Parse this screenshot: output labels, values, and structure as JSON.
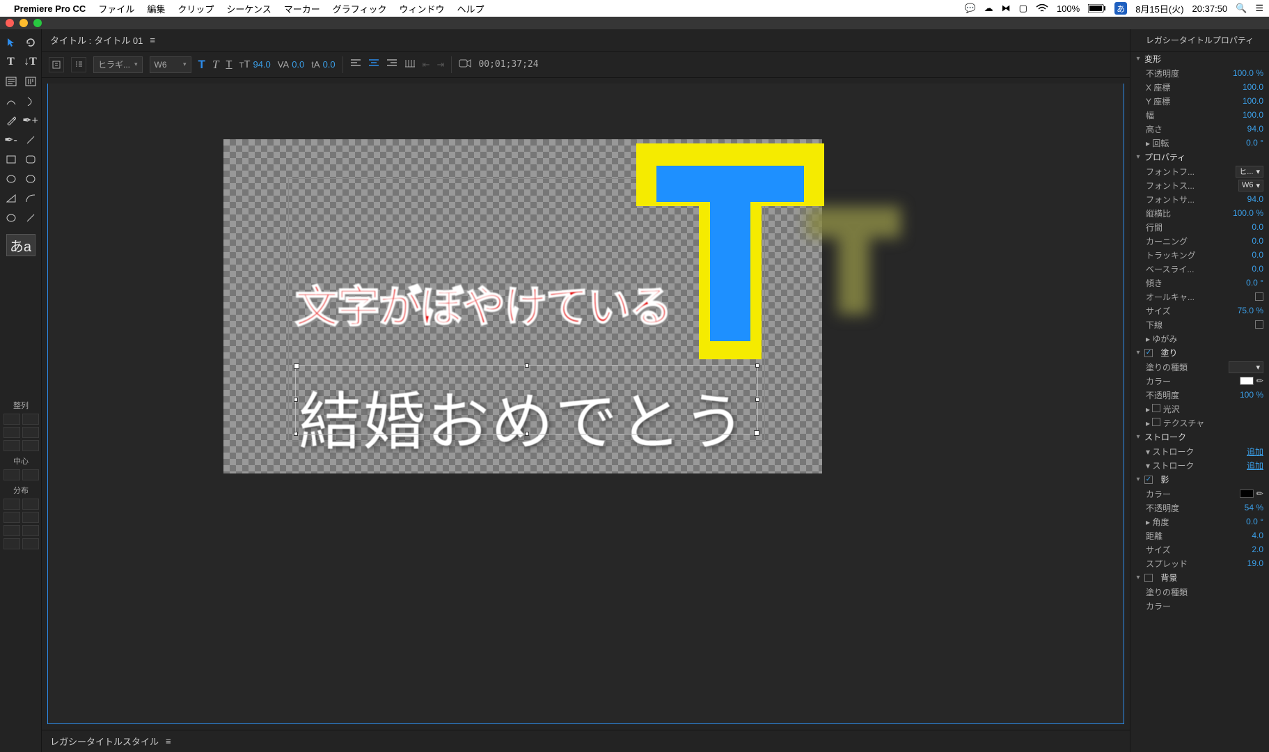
{
  "menubar": {
    "app": "Premiere Pro CC",
    "items": [
      "ファイル",
      "編集",
      "クリップ",
      "シーケンス",
      "マーカー",
      "グラフィック",
      "ウィンドウ",
      "ヘルプ"
    ],
    "battery": "100%",
    "ime": "あ",
    "date": "8月15日(火)",
    "time": "20:37:50"
  },
  "window": {
    "title_prefix": "タイトル : ",
    "title": "タイトル 01"
  },
  "toolbar": {
    "font": "ヒラギ...",
    "weight": "W6",
    "size": "94.0",
    "kerning": "0.0",
    "leading": "0.0",
    "timecode": "00;01;37;24"
  },
  "canvas": {
    "red_text": "文字がぼやけている",
    "white_text": "結婚おめでとう"
  },
  "styles": {
    "title": "レガシータイトルスタイル"
  },
  "align": {
    "title": "整列",
    "center": "中心",
    "dist": "分布"
  },
  "aa": "あa",
  "props": {
    "title": "レガシータイトルプロパティ",
    "transform": {
      "label": "変形",
      "opacity_k": "不透明度",
      "opacity_v": "100.0 %",
      "x_k": "X 座標",
      "x_v": "100.0",
      "y_k": "Y 座標",
      "y_v": "100.0",
      "w_k": "幅",
      "w_v": "100.0",
      "h_k": "高さ",
      "h_v": "94.0",
      "rot_k": "回転",
      "rot_v": "0.0 °"
    },
    "prop": {
      "label": "プロパティ",
      "fontfam_k": "フォントフ...",
      "fontfam_v": "ヒ...",
      "fontstyle_k": "フォントス...",
      "fontstyle_v": "W6",
      "fontsize_k": "フォントサ...",
      "fontsize_v": "94.0",
      "aspect_k": "縦横比",
      "aspect_v": "100.0 %",
      "leading_k": "行間",
      "leading_v": "0.0",
      "kerning_k": "カーニング",
      "kerning_v": "0.0",
      "tracking_k": "トラッキング",
      "tracking_v": "0.0",
      "baseline_k": "ベースライ...",
      "baseline_v": "0.0",
      "slant_k": "傾き",
      "slant_v": "0.0 °",
      "allcaps_k": "オールキャ...",
      "size_k": "サイズ",
      "size_v": "75.0 %",
      "underline_k": "下線",
      "distort_k": "ゆがみ"
    },
    "fill": {
      "label": "塗り",
      "type_k": "塗りの種類",
      "color_k": "カラー",
      "opacity_k": "不透明度",
      "opacity_v": "100 %",
      "sheen_k": "光沢",
      "texture_k": "テクスチャ"
    },
    "stroke": {
      "label": "ストローク",
      "inner": "ストローク",
      "outer": "ストローク",
      "add": "追加"
    },
    "shadow": {
      "label": "影",
      "color_k": "カラー",
      "opacity_k": "不透明度",
      "opacity_v": "54 %",
      "angle_k": "角度",
      "angle_v": "0.0 °",
      "dist_k": "距離",
      "dist_v": "4.0",
      "size_k": "サイズ",
      "size_v": "2.0",
      "spread_k": "スプレッド",
      "spread_v": "19.0"
    },
    "bg": {
      "label": "背景",
      "type_k": "塗りの種類",
      "color_k": "カラー"
    }
  }
}
